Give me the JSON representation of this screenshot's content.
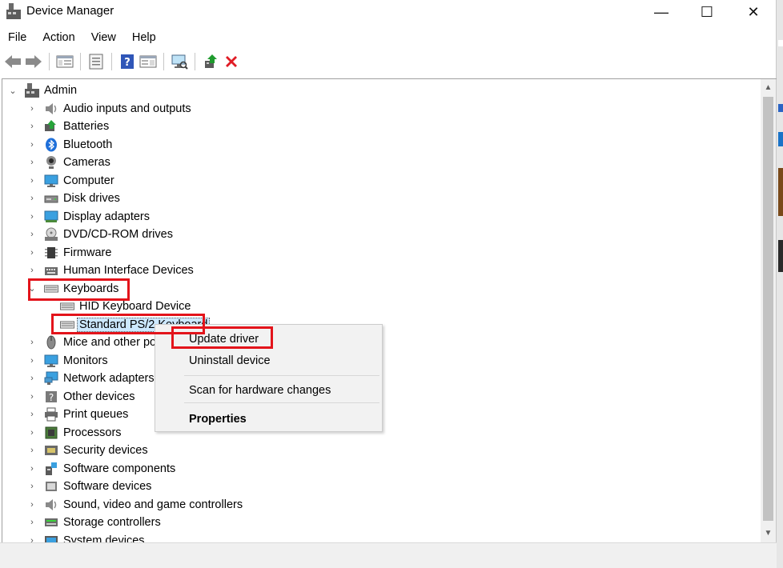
{
  "window": {
    "title": "Device Manager",
    "minimize_glyph": "—",
    "maximize_glyph": "☐",
    "close_glyph": "✕"
  },
  "menu": [
    "File",
    "Action",
    "View",
    "Help"
  ],
  "toolbar": {
    "buttons": [
      "back-arrow-icon",
      "forward-arrow-icon",
      "show-hide-console-tree-icon",
      "properties-icon",
      "help-icon",
      "action-pane-icon",
      "scan-hardware-icon",
      "update-driver-icon",
      "uninstall-device-icon"
    ]
  },
  "tree": {
    "root": "Admin",
    "categories": [
      "Audio inputs and outputs",
      "Batteries",
      "Bluetooth",
      "Cameras",
      "Computer",
      "Disk drives",
      "Display adapters",
      "DVD/CD-ROM drives",
      "Firmware",
      "Human Interface Devices",
      "Keyboards",
      "Mice and other po",
      "Monitors",
      "Network adapters",
      "Other devices",
      "Print queues",
      "Processors",
      "Security devices",
      "Software components",
      "Software devices",
      "Sound, video and game controllers",
      "Storage controllers",
      "System devices"
    ],
    "keyboard_children": [
      "HID Keyboard Device",
      "Standard PS/2 Keyboard"
    ]
  },
  "context_menu": {
    "update_driver": "Update driver",
    "uninstall_device": "Uninstall device",
    "scan_hardware": "Scan for hardware changes",
    "properties": "Properties"
  },
  "colors": {
    "highlight": "#e3141b",
    "selection": "#cce8ff",
    "menu_bg": "#f2f2f2"
  }
}
